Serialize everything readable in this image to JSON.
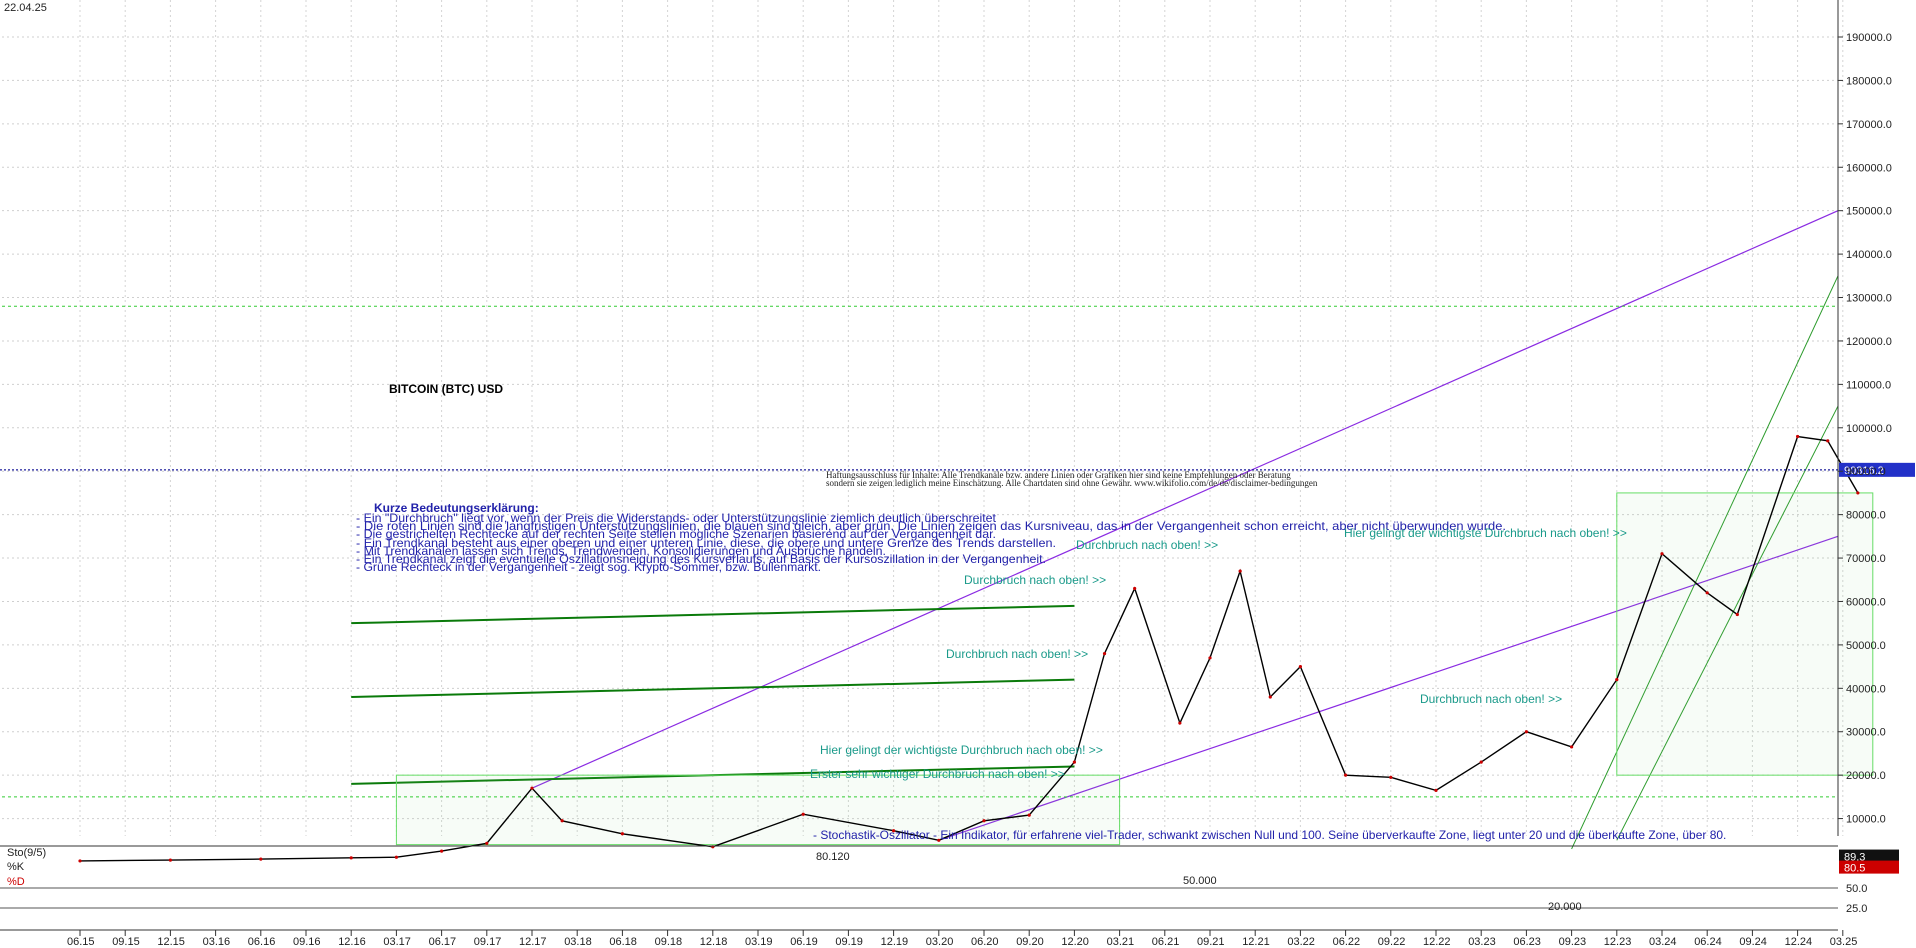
{
  "header": {
    "date": "22.04.25"
  },
  "chart_data": {
    "type": "line",
    "title": "BITCOIN (BTC) USD",
    "instrument": "BITCOIN (BTC) USD",
    "y_scale": "log",
    "ylim": [
      0,
      190000
    ],
    "y_ticks": [
      {
        "v": 190000,
        "l": "190000.0"
      },
      {
        "v": 180000,
        "l": "180000.0"
      },
      {
        "v": 170000,
        "l": "170000.0"
      },
      {
        "v": 160000,
        "l": "160000.0"
      },
      {
        "v": 150000,
        "l": "150000.0"
      },
      {
        "v": 140000,
        "l": "140000.0"
      },
      {
        "v": 130000,
        "l": "130000.0"
      },
      {
        "v": 120000,
        "l": "120000.0"
      },
      {
        "v": 110000,
        "l": "110000.0"
      },
      {
        "v": 100000,
        "l": "100000.0"
      },
      {
        "v": 90000,
        "l": "90000.0"
      },
      {
        "v": 80000,
        "l": "80000.0"
      },
      {
        "v": 70000,
        "l": "70000.0"
      },
      {
        "v": 60000,
        "l": "60000.0"
      },
      {
        "v": 50000,
        "l": "50000.0"
      },
      {
        "v": 40000,
        "l": "40000.0"
      },
      {
        "v": 30000,
        "l": "30000.0"
      },
      {
        "v": 20000,
        "l": "20000.0"
      },
      {
        "v": 10000,
        "l": "10000.0"
      }
    ],
    "x_ticks": [
      "06.15",
      "09.15",
      "12.15",
      "03.16",
      "06.16",
      "09.16",
      "12.16",
      "03.17",
      "06.17",
      "09.17",
      "12.17",
      "03.18",
      "06.18",
      "09.18",
      "12.18",
      "03.19",
      "06.19",
      "09.19",
      "12.19",
      "03.20",
      "06.20",
      "09.20",
      "12.20",
      "03.21",
      "06.21",
      "09.21",
      "12.21",
      "03.22",
      "06.22",
      "09.22",
      "12.22",
      "03.23",
      "06.23",
      "09.23",
      "12.23",
      "03.24",
      "06.24",
      "09.24",
      "12.24",
      "03.25"
    ],
    "price_series": {
      "name": "BTC",
      "x": [
        "06.15",
        "12.15",
        "06.16",
        "12.16",
        "03.17",
        "06.17",
        "09.17",
        "12.17",
        "02.18",
        "06.18",
        "12.18",
        "06.19",
        "12.19",
        "03.20",
        "06.20",
        "09.20",
        "12.20",
        "02.21",
        "04.21",
        "07.21",
        "09.21",
        "11.21",
        "01.22",
        "03.22",
        "06.22",
        "09.22",
        "12.22",
        "03.23",
        "06.23",
        "09.23",
        "12.23",
        "03.24",
        "06.24",
        "08.24",
        "12.24",
        "02.25",
        "04.25"
      ],
      "values": [
        250,
        430,
        670,
        960,
        1100,
        2500,
        4300,
        17000,
        9500,
        6500,
        3500,
        11000,
        7200,
        5000,
        9500,
        10800,
        23000,
        48000,
        63000,
        32000,
        47000,
        67000,
        38000,
        45000,
        20000,
        19500,
        16500,
        23000,
        30000,
        26500,
        42000,
        71000,
        62000,
        57000,
        98000,
        97000,
        85000
      ]
    },
    "current_price": {
      "label": "90316.2",
      "value": 90316.2
    },
    "stochastic": {
      "name": "Sto(9/5)",
      "k_label": "%K",
      "d_label": "%D",
      "k_value": "89.3",
      "d_value": "80.5",
      "levels": [
        {
          "v": 25,
          "l": "25.0"
        },
        {
          "v": 50,
          "l": "50.0"
        }
      ],
      "annotations": [
        "80.120",
        "50.000",
        "20.000"
      ]
    },
    "annotations": {
      "legend_title": "Kurze Bedeutungserklärung:",
      "legend_lines": [
        "- Ein \"Durchbruch\" liegt vor, wenn der Preis die Widerstands- oder Unterstützungslinie ziemlich deutlich überschreitet",
        "- Die roten Linien sind die langfristigen Unterstützungslinien, die blauen sind gleich, aber grün. Die Linien zeigen das Kursniveau, das in der Vergangenheit schon erreicht, aber nicht überwunden wurde.",
        "- Die gestrichelten Rechtecke auf der rechten Seite stellen mögliche Szenarien basierend auf der Vergangenheit dar.",
        "- Ein Trendkanal besteht aus einer oberen und einer unteren Linie, diese, die obere und untere Grenze des Trends darstellen.",
        "- Mit Trendkanälen lassen sich Trends, Trendwenden, Konsolidierungen und Ausbrüche handeln.",
        "- Ein Trendkanal zeigt die eventuelle Oszillationsneigung des Kursverlaufs, auf Basis der Kursoszillation in der Vergangenheit.",
        "- Grüne Rechteck in der Vergangenheit - zeigt sog. Krypto-Sommer, bzw. Bullenmarkt."
      ],
      "disclaimer_1": "Haftungsausschluss für Inhalte: Alle Trendkanäle bzw. andere Linien oder Grafiken hier sind keine Empfehlungen oder Beratung",
      "disclaimer_2": "sondern sie zeigen lediglich meine Einschätzung. Alle Chartdaten sind ohne Gewähr. www.wikifolio.com/de/de/disclaimer-bedingungen",
      "breakout_1": "Durchbruch nach oben! >>",
      "breakout_2": "Durchbruch nach oben! >>",
      "breakout_3": "Durchbruch nach oben! >>",
      "breakout_4": "Durchbruch nach oben! >>",
      "important_1": "Hier gelingt der wichtigste Durchbruch nach oben! >>",
      "important_2": "Hier gelingt der wichtigste Durchbruch nach oben! >>",
      "first_breakout": "Erster sehr wichtiger Durchbruch nach oben! >>",
      "stoch_note": "- Stochastik-Oszillator - Ein Indikator, für erfahrene viel-Trader, schwankt zwischen Null und 100. Seine überverkaufte Zone, liegt unter 20 und die überkaufte Zone, über 80."
    },
    "grid": true
  }
}
